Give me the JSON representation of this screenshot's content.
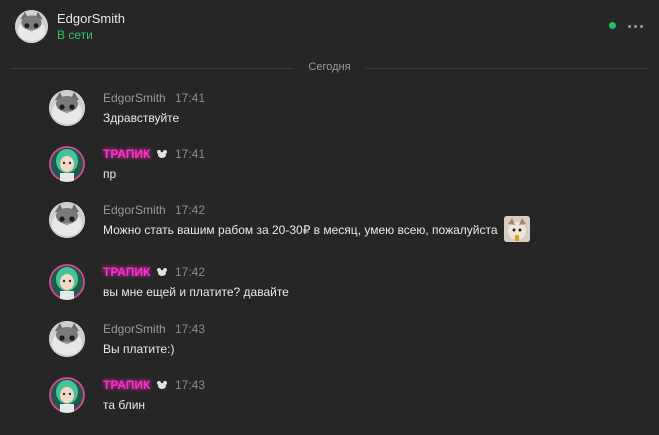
{
  "header": {
    "name": "EdgorSmith",
    "status": "В сети",
    "icons": [
      "cat-avatar-icon",
      "online-dot-icon",
      "more-icon"
    ]
  },
  "divider": {
    "label": "Сегодня"
  },
  "messages": [
    {
      "author": "EdgorSmith",
      "time": "17:41",
      "text": "Здравствуйте",
      "avatar": "cat"
    },
    {
      "author": "ТРАПИК",
      "time": "17:41",
      "text": "пр",
      "avatar": "girl"
    },
    {
      "author": "EdgorSmith",
      "time": "17:42",
      "text": "Можно стать вашим рабом за 20-30₽ в месяц, умею всею, пожалуйста",
      "avatar": "cat",
      "has_sticker": true
    },
    {
      "author": "ТРАПИК",
      "time": "17:42",
      "text": "вы мне ещей и платите? давайте",
      "avatar": "girl"
    },
    {
      "author": "EdgorSmith",
      "time": "17:43",
      "text": "Вы платите:)",
      "avatar": "cat"
    },
    {
      "author": "ТРАПИК",
      "time": "17:43",
      "text": "та блин",
      "avatar": "girl"
    }
  ],
  "colors": {
    "background": "#262626",
    "online": "#32c36b",
    "trapik_name": "#ff2ec9"
  }
}
